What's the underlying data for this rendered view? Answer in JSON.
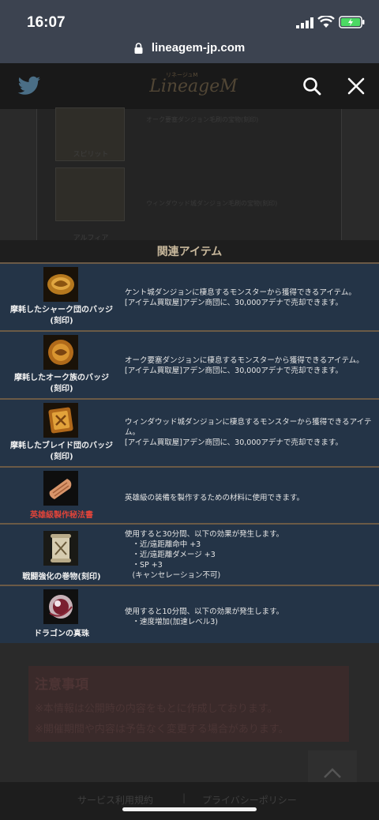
{
  "status_bar": {
    "time": "16:07"
  },
  "browser": {
    "url": "lineagem-jp.com"
  },
  "header": {
    "logo_text": "LineageM",
    "logo_sub": "リネージュM"
  },
  "background_table": {
    "rows": [
      {
        "label": "スピリット",
        "desc": "オーク要塞ダンジョン毛刷の宝物(刻印)"
      },
      {
        "label": "アルフィア",
        "desc": "ウィンダウッド城ダンジョン毛刷の宝物(刻印)"
      }
    ]
  },
  "related": {
    "title": "関連アイテム",
    "items": [
      {
        "name": "摩耗したシャーク団のバッジ\n(刻印)",
        "icon": "badge-shark-icon",
        "desc": "ケント城ダンジョンに棲息するモンスターから獲得できるアイテム。\n[アイテム買取屋]アデン商団に、30,000アデナで売却できます。"
      },
      {
        "name": "摩耗したオーク族のバッジ\n(刻印)",
        "icon": "badge-orc-icon",
        "desc": "オーク要塞ダンジョンに棲息するモンスターから獲得できるアイテム。\n[アイテム買取屋]アデン商団に、30,000アデナで売却できます。"
      },
      {
        "name": "摩耗したブレイド団のバッジ\n(刻印)",
        "icon": "badge-blade-icon",
        "desc": "ウィンダウッド城ダンジョンに棲息するモンスターから獲得できるアイテ\nム。\n[アイテム買取屋]アデン商団に、30,000アデナで売却できます。"
      },
      {
        "name": "英雄級製作秘法書",
        "icon": "scroll-recipe-icon",
        "desc": "英雄級の装備を製作するための材料に使用できます。"
      },
      {
        "name": "戦闘強化の巻物(刻印)",
        "icon": "scroll-battle-icon",
        "desc": "使用すると30分間、以下の効果が発生します。\n　・近/遠距離命中 +3\n　・近/遠距離ダメージ +3\n　・SP +3\n　(キャンセレーション不可)"
      },
      {
        "name": "ドラゴンの真珠",
        "icon": "dragon-pearl-icon",
        "desc": "使用すると10分間、以下の効果が発生します。\n　・速度増加(加速レベル3)"
      }
    ]
  },
  "notice": {
    "title": "注意事項",
    "lines": [
      "※本情報は公開時の内容をもとに作成しております。",
      "※開催期間や内容は予告なく変更する場合があります。"
    ]
  },
  "footer": {
    "terms": "サービス利用規約",
    "separator": "|",
    "privacy": "プライバシーポリシー"
  },
  "colors": {
    "row_bg": "#243447",
    "divider": "#6b5a46",
    "red_label": "#e0443a"
  }
}
